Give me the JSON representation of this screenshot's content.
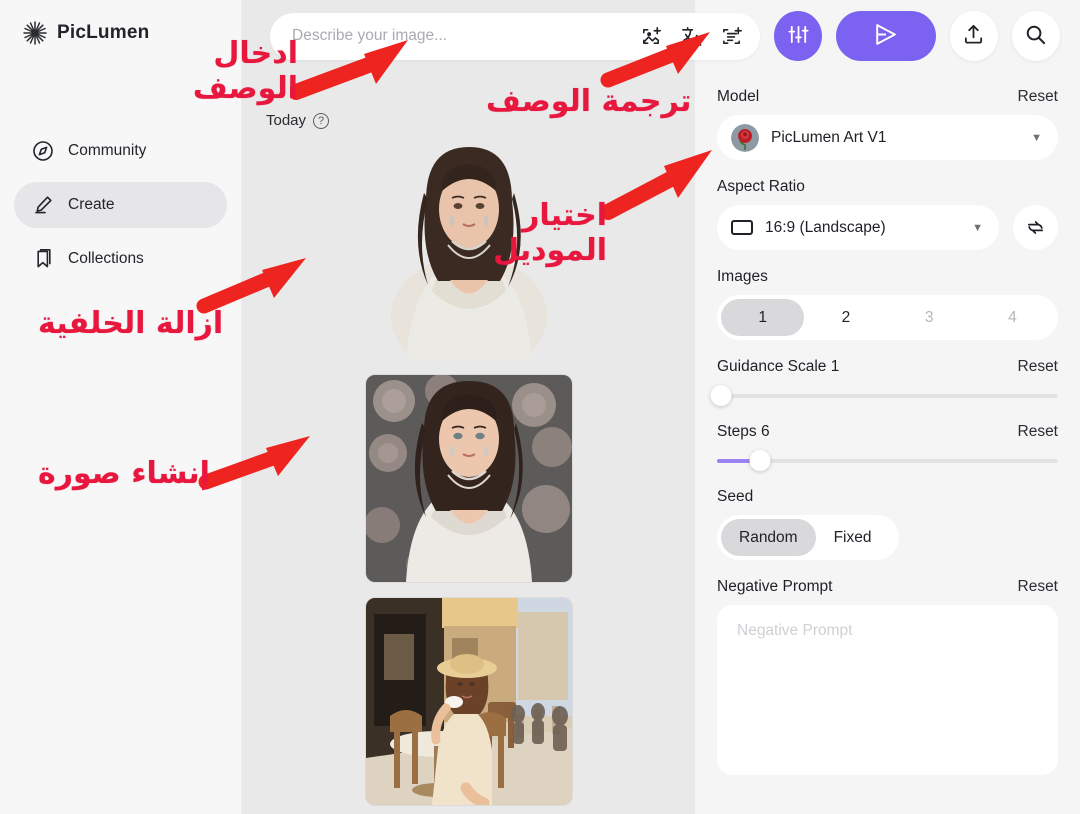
{
  "brand": {
    "name": "PicLumen",
    "logo_icon": "starburst-icon"
  },
  "sidebar": {
    "items": [
      {
        "label": "Community",
        "icon": "compass-icon",
        "active": false
      },
      {
        "label": "Create",
        "icon": "pen-create-icon",
        "active": true
      },
      {
        "label": "Collections",
        "icon": "bookmark-icon",
        "active": false
      }
    ]
  },
  "topbar": {
    "prompt": {
      "value": "",
      "placeholder": "Describe your image...",
      "icons": [
        {
          "name": "image-plus-icon"
        },
        {
          "name": "translate-icon",
          "glyph": "文A"
        },
        {
          "name": "prompt-library-icon"
        }
      ]
    },
    "settings_button": {
      "icon": "sliders-icon",
      "label": ""
    },
    "generate_button": {
      "icon": "send-arrow-icon",
      "label": ""
    },
    "upload_button": {
      "icon": "upload-icon",
      "label": ""
    },
    "search_button": {
      "icon": "search-icon",
      "label": ""
    },
    "accent_color": "#7b62f0"
  },
  "gallery": {
    "group_label": "Today",
    "help_icon": "question-circle-icon",
    "items": [
      {
        "name": "portrait-white-dress-no-background",
        "caption": ""
      },
      {
        "name": "portrait-floral-roses-background",
        "caption": ""
      },
      {
        "name": "woman-cafe-street-scene",
        "caption": ""
      }
    ]
  },
  "panel": {
    "model": {
      "label": "Model",
      "reset": "Reset",
      "value": "PicLumen Art V1",
      "thumb_icon": "rose-thumbnail-icon"
    },
    "aspect_ratio": {
      "label": "Aspect Ratio",
      "value": "16:9  (Landscape)",
      "rect_icon": "rectangle-landscape-icon",
      "refresh_icon": "refresh-swap-icon"
    },
    "images": {
      "label": "Images",
      "options": [
        "1",
        "2",
        "3",
        "4"
      ],
      "selected": "1",
      "disabled": [
        "3",
        "4"
      ]
    },
    "guidance_scale": {
      "label": "Guidance Scale 1",
      "reset": "Reset",
      "value": 1,
      "percent": 1
    },
    "steps": {
      "label": "Steps 6",
      "reset": "Reset",
      "value": 6,
      "percent": 12
    },
    "seed": {
      "label": "Seed",
      "options": [
        "Random",
        "Fixed"
      ],
      "selected": "Random"
    },
    "negative_prompt": {
      "label": "Negative Prompt",
      "reset": "Reset",
      "value": "",
      "placeholder": "Negative Prompt"
    }
  },
  "annotations": {
    "color": "#e8173d",
    "items": [
      {
        "name": "annotation-enter-description",
        "line1": "ادخال",
        "line2": "الوصف"
      },
      {
        "name": "annotation-translate-description",
        "line1": "ترجمة الوصف",
        "line2": ""
      },
      {
        "name": "annotation-select-model",
        "line1": "اختيار",
        "line2": "الموديل"
      },
      {
        "name": "annotation-remove-background",
        "line1": "ازالة الخلفية",
        "line2": ""
      },
      {
        "name": "annotation-create-image",
        "line1": "إنشاء صورة",
        "line2": ""
      }
    ]
  }
}
